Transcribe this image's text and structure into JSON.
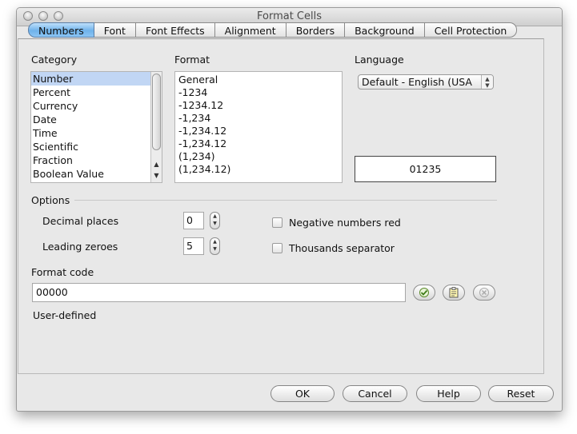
{
  "window": {
    "title": "Format Cells"
  },
  "tabs": [
    {
      "label": "Numbers",
      "active": true
    },
    {
      "label": "Font",
      "active": false
    },
    {
      "label": "Font Effects",
      "active": false
    },
    {
      "label": "Alignment",
      "active": false
    },
    {
      "label": "Borders",
      "active": false
    },
    {
      "label": "Background",
      "active": false
    },
    {
      "label": "Cell Protection",
      "active": false
    }
  ],
  "category": {
    "label": "Category",
    "items": [
      "Number",
      "Percent",
      "Currency",
      "Date",
      "Time",
      "Scientific",
      "Fraction",
      "Boolean Value"
    ],
    "selected": "Number"
  },
  "format": {
    "label": "Format",
    "items": [
      "General",
      "-1234",
      "-1234.12",
      "-1,234",
      "-1,234.12",
      "-1,234.12",
      "(1,234)",
      "(1,234.12)"
    ]
  },
  "language": {
    "label": "Language",
    "value": "Default - English (USA"
  },
  "preview": {
    "value": "01235"
  },
  "options": {
    "label": "Options",
    "decimal_places_label": "Decimal places",
    "decimal_places_value": "0",
    "leading_zeroes_label": "Leading zeroes",
    "leading_zeroes_value": "5",
    "negative_red_label": "Negative numbers red",
    "negative_red_checked": false,
    "thousands_sep_label": "Thousands separator",
    "thousands_sep_checked": false
  },
  "format_code": {
    "label": "Format code",
    "value": "00000",
    "description": "User-defined"
  },
  "buttons": {
    "ok": "OK",
    "cancel": "Cancel",
    "help": "Help",
    "reset": "Reset"
  }
}
